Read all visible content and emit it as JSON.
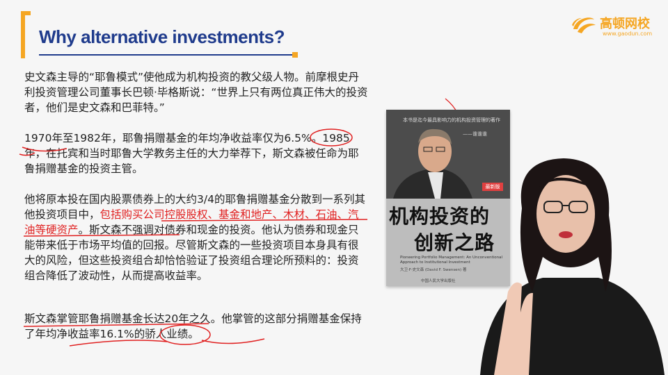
{
  "title": "Why alternative investments?",
  "logo": {
    "name": "高顿网校",
    "url": "www.gaodun.com"
  },
  "paragraphs": {
    "p1": "史文森主导的“耶鲁模式”使他成为机构投资的教父级人物。前摩根史丹利投资管理公司董事长巴顿·毕格斯说：“世界上只有两位真正伟大的投资者，他们是史文森和巴菲特。”",
    "p2": "1970年至1982年，耶鲁捐赠基金的年均净收益率仅为6.5%。1985年，在托宾和当时耶鲁大学教务主任的大力举荐下，斯文森被任命为耶鲁捐赠基金的投资主管。",
    "p3_a": "他将原本投在国内股票债券上的大约3/4的耶鲁捐赠基金分散到一系列其他投资项目中，",
    "p3_red": "包括购买公司控股股权、基金和地产、木材、石油、汽油等硬资产",
    "p3_b": "。斯文森不强调对债券和现金的投资。他认为债券和现金只能带来低于市场平均值的回报。尽管斯文森的一些投资项目本身具有很大的风险，但这些投资组合却恰恰验证了投资组合理论所预料的：投资组合降低了波动性，从而提高收益率。",
    "p4": "斯文森掌管耶鲁捐赠基金长达20年之久。他掌管的这部分捐赠基金保持了年均净收益率16.1%的骄人业绩。"
  },
  "book": {
    "blurb": "本书是迄今最具影响力的机构投资管理的著作",
    "blurb_attr": "——谁谁谁",
    "badge": "最新版",
    "title_line1": "机构投资的",
    "title_line2": "创新之路",
    "english": "Pioneering Portfolio Management: An Unconventional Approach to Institutional Investment",
    "authors": "大卫·F·史文森 (David F. Swensen) 著",
    "publisher": "中国人民大学出版社"
  },
  "colors": {
    "title": "#1f3b8c",
    "accent": "#f5a623",
    "annotation": "#e02020"
  }
}
